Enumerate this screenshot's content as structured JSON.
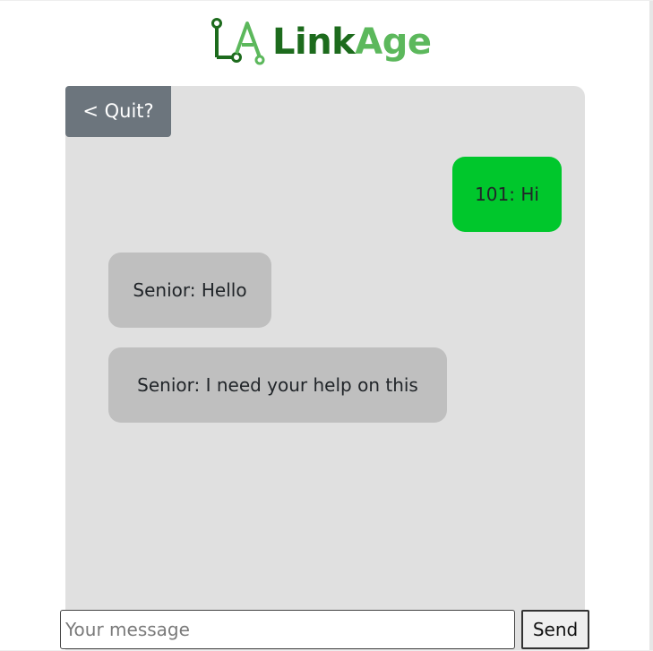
{
  "header": {
    "logo_text_link": "Link",
    "logo_text_age": "Age",
    "logo_icon": "la-circuit-logo-icon"
  },
  "chat": {
    "quit_label": "< Quit?",
    "messages": [
      {
        "sender": "101",
        "text": "101: Hi",
        "direction": "sent"
      },
      {
        "sender": "Senior",
        "text": "Senior: Hello",
        "direction": "received"
      },
      {
        "sender": "Senior",
        "text": "Senior: I need your help on this",
        "direction": "received"
      }
    ]
  },
  "composer": {
    "placeholder": "Your message",
    "value": "",
    "send_label": "Send"
  },
  "colors": {
    "brand_dark_green": "#1d6b1d",
    "brand_light_green": "#5cb85c",
    "sent_bubble": "#00c72c",
    "received_bubble": "#bfbfbf",
    "chat_background": "#e0e0e0",
    "quit_button": "#6c757d"
  }
}
